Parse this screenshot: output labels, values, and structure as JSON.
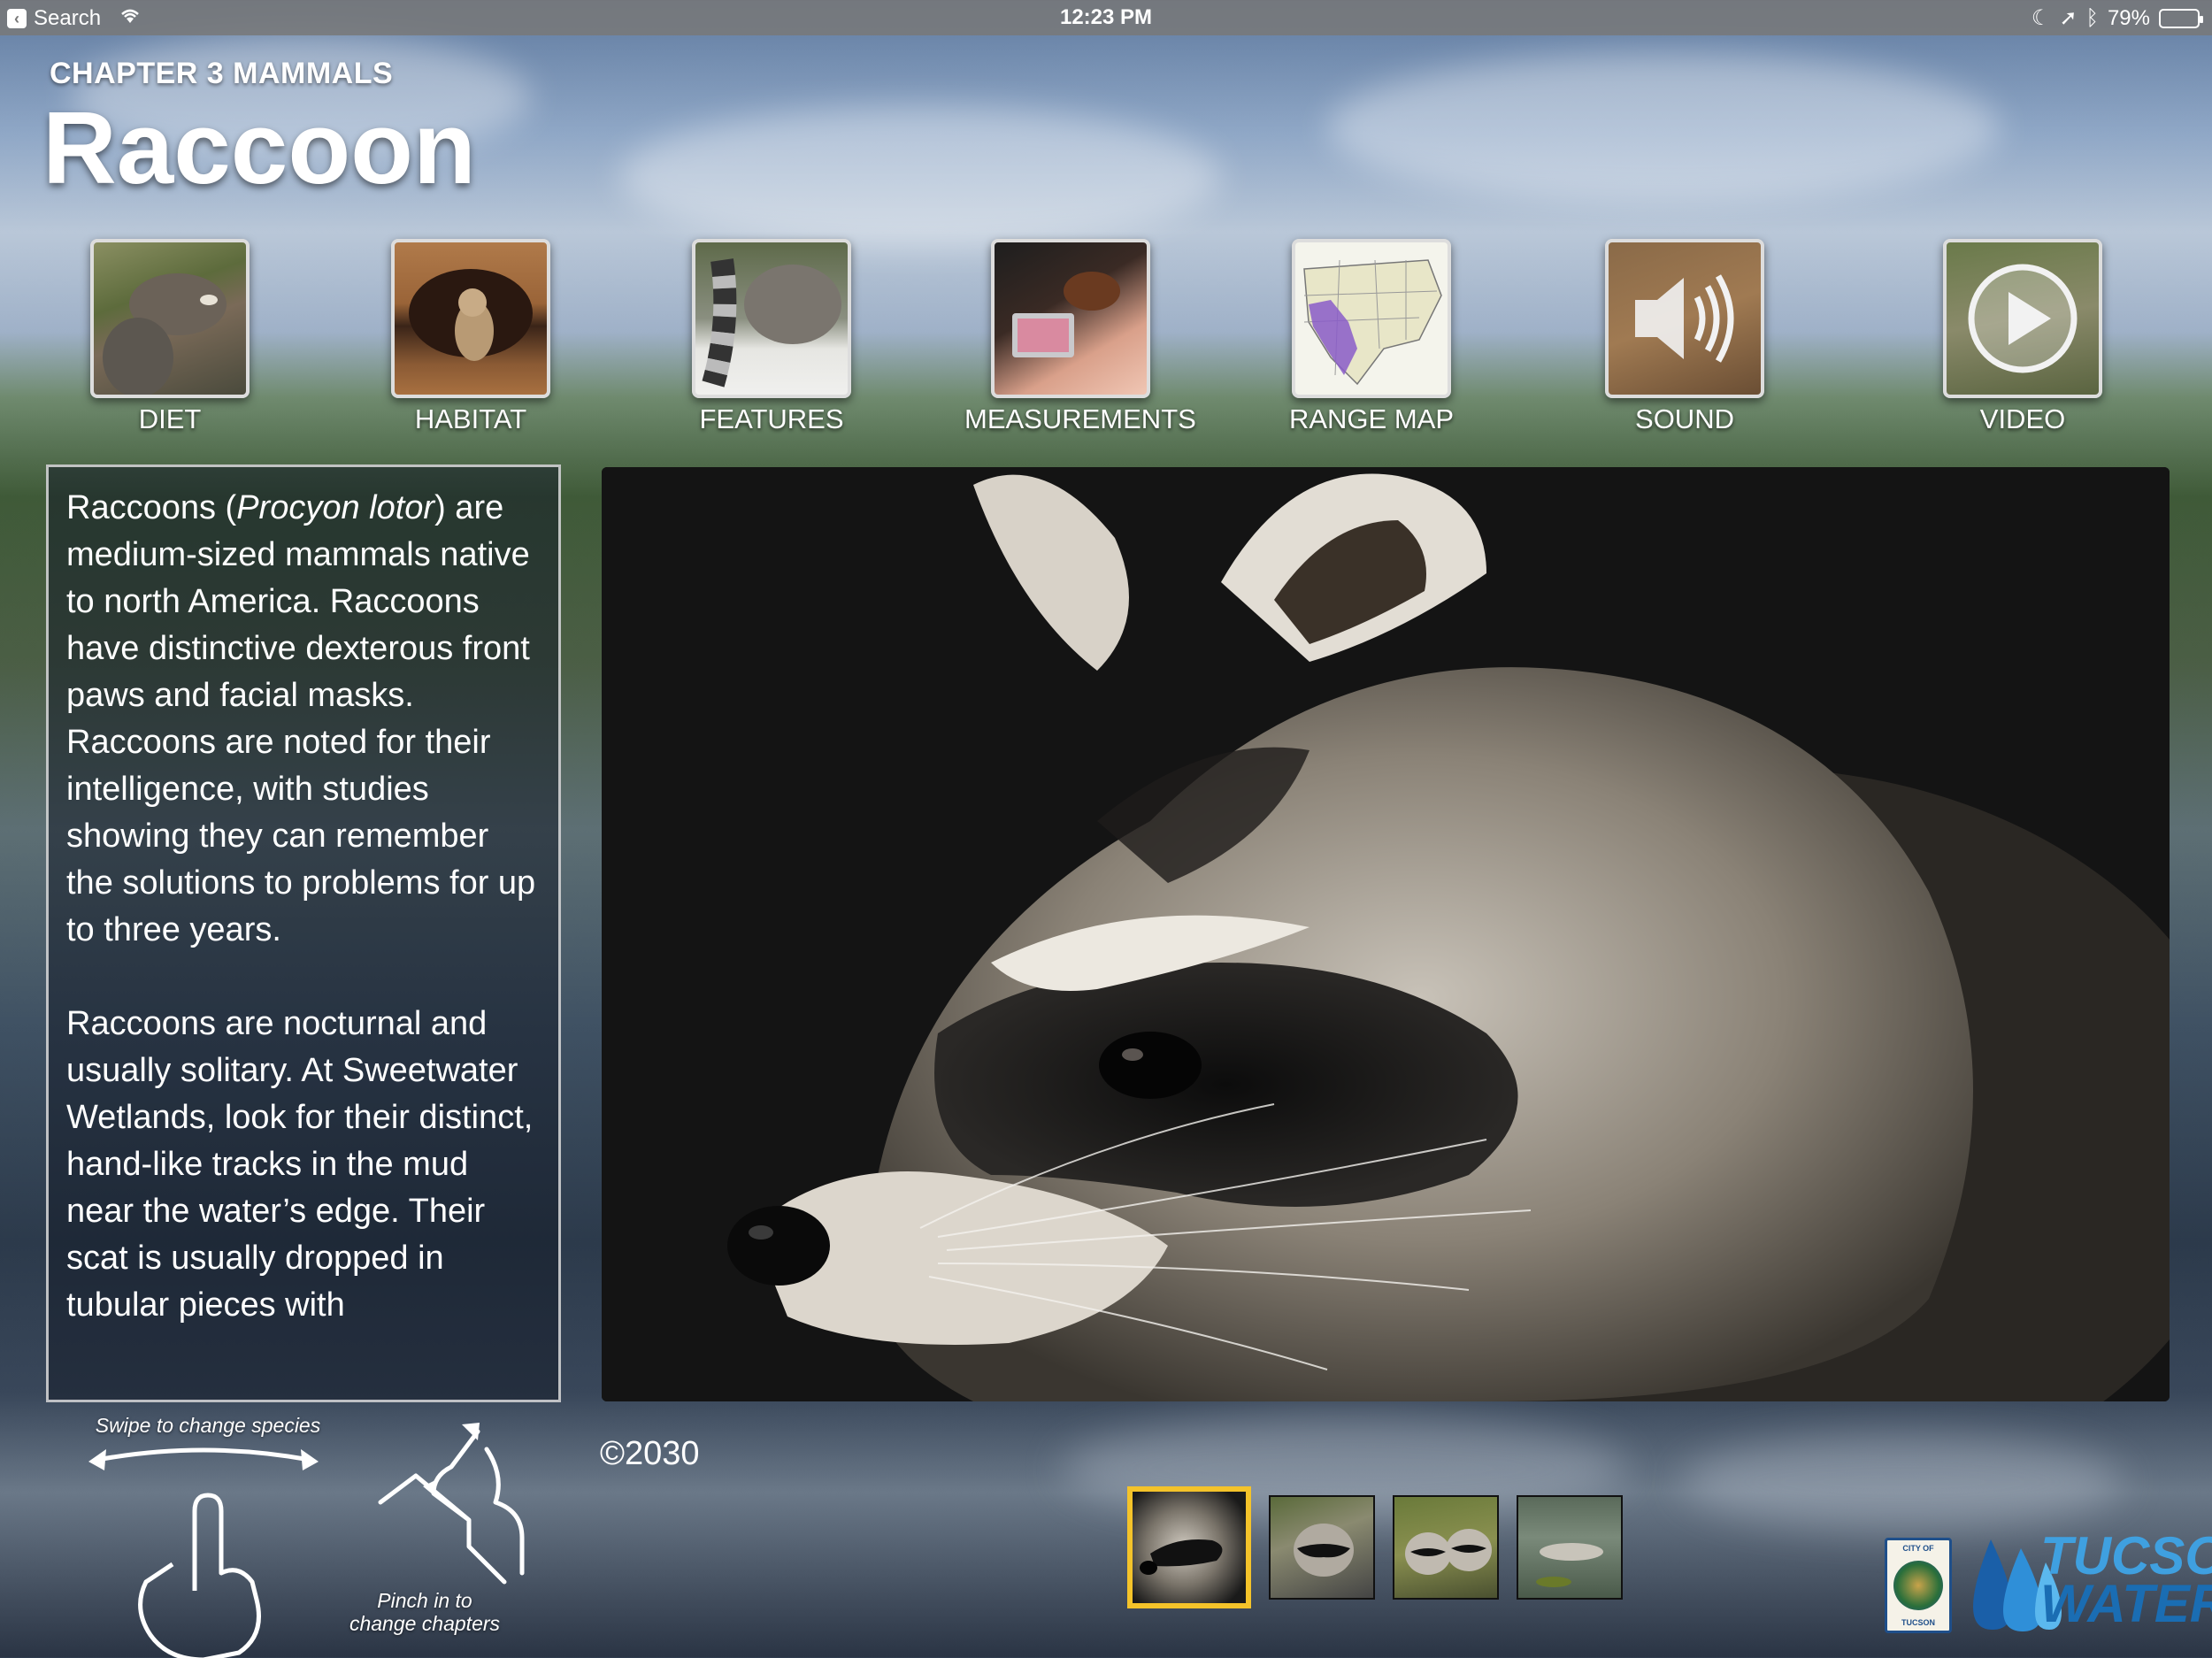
{
  "status_bar": {
    "back_label": "Search",
    "time": "12:23 PM",
    "battery_percent": "79%",
    "battery_level": 0.79,
    "icons": [
      "back-chevron-icon",
      "wifi-icon",
      "moon-icon",
      "location-arrow-icon",
      "bluetooth-icon",
      "battery-icon"
    ]
  },
  "header": {
    "chapter": "CHAPTER 3 MAMMALS",
    "title": "Raccoon"
  },
  "nav": {
    "items": [
      {
        "label": "DIET",
        "thumb": "diet-photo"
      },
      {
        "label": "HABITAT",
        "thumb": "habitat-photo"
      },
      {
        "label": "FEATURES",
        "thumb": "features-photo"
      },
      {
        "label": "MEASUREMENTS",
        "thumb": "measurements-photo"
      },
      {
        "label": "RANGE MAP",
        "thumb": "range-map"
      },
      {
        "label": "SOUND",
        "thumb": "speaker-icon"
      },
      {
        "label": "VIDEO",
        "thumb": "play-icon"
      }
    ]
  },
  "description": {
    "p1_before": "Raccoons (",
    "p1_italic": "Procyon lotor",
    "p1_after": ") are medium-sized mammals native to north America. Raccoons have distinctive dexterous front paws and facial masks. Raccoons are noted for their intelligence, with studies showing they can remember the solutions to problems for up to three years.",
    "p2": "Raccoons are nocturnal and usually solitary. At Sweetwater Wetlands, look for their distinct, hand-like tracks in the mud near the water’s edge. Their scat is usually dropped in tubular pieces with"
  },
  "copyright": "©2030",
  "gestures": {
    "swipe_hint": "Swipe to change species",
    "pinch_hint_line1": "Pinch in to",
    "pinch_hint_line2": "change chapters"
  },
  "gallery": {
    "selected_index": 0,
    "count": 4
  },
  "logo": {
    "seal_top": "CITY OF",
    "seal_bottom": "TUCSON",
    "line1": "TUCSON",
    "line2": "WATER"
  },
  "colors": {
    "selected_thumb_border": "#f4c32a",
    "range_map_highlight": "#8a5cc9",
    "logo_light_blue": "#3fa0e0",
    "logo_dark_blue": "#1a6db3"
  }
}
